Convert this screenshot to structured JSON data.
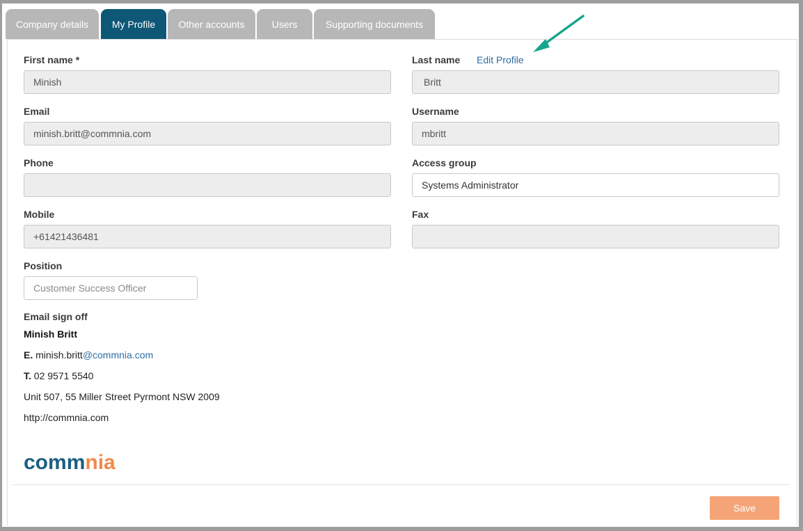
{
  "tabs": [
    {
      "label": "Company details"
    },
    {
      "label": "My Profile"
    },
    {
      "label": "Other accounts"
    },
    {
      "label": "Users"
    },
    {
      "label": "Supporting documents"
    }
  ],
  "active_tab": "My Profile",
  "form": {
    "first_name": {
      "label": "First name *",
      "value": "Minish"
    },
    "last_name": {
      "label": "Last name",
      "value": "Britt"
    },
    "edit_profile_link": "Edit Profile",
    "email": {
      "label": "Email",
      "value": "minish.britt@commnia.com"
    },
    "username": {
      "label": "Username",
      "value": "mbritt"
    },
    "phone": {
      "label": "Phone",
      "value": ""
    },
    "access_group": {
      "label": "Access group",
      "value": "Systems Administrator"
    },
    "mobile": {
      "label": "Mobile",
      "value": "+61421436481"
    },
    "fax": {
      "label": "Fax",
      "value": ""
    },
    "position": {
      "label": "Position",
      "placeholder": "Customer Success Officer"
    }
  },
  "signoff": {
    "label": "Email sign off",
    "name": "Minish Britt",
    "email_prefix": "E.",
    "email_user": "minish.britt",
    "email_domain": "@commnia.com",
    "phone_prefix": "T.",
    "phone": "02 9571 5540",
    "address": "Unit 507, 55 Miller Street Pyrmont NSW 2009",
    "website": "http://commnia.com"
  },
  "logo": {
    "text": "commnia",
    "part1": "co",
    "part2": "mm",
    "part3": "nia",
    "colors": {
      "blue": "#1b5f80",
      "orange": "#f08a4b"
    }
  },
  "save_label": "Save",
  "colors": {
    "active_tab": "#0e5777",
    "inactive_tab": "#b7b7b7",
    "save_button": "#f5a478",
    "annotation_arrow": "#17a58c",
    "link": "#2e6da4"
  }
}
